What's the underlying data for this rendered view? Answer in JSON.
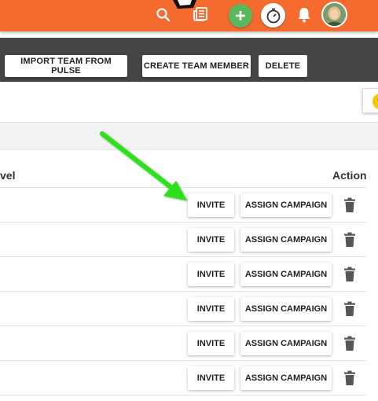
{
  "header": {
    "brand_color": "#f46a2f",
    "icons": [
      "search-icon",
      "newspaper-icon",
      "add-icon",
      "timer-icon",
      "bell-icon",
      "avatar"
    ]
  },
  "toolbar": {
    "import_label": "IMPORT TEAM FROM PULSE",
    "create_label": "CREATE TEAM MEMBER",
    "delete_label": "DELETE"
  },
  "help": {
    "label": "?"
  },
  "table": {
    "columns": {
      "level": "vel",
      "action": "Action"
    },
    "rows": [
      {
        "invite": "INVITE",
        "assign": "ASSIGN CAMPAIGN"
      },
      {
        "invite": "INVITE",
        "assign": "ASSIGN CAMPAIGN"
      },
      {
        "invite": "INVITE",
        "assign": "ASSIGN CAMPAIGN"
      },
      {
        "invite": "INVITE",
        "assign": "ASSIGN CAMPAIGN"
      },
      {
        "invite": "INVITE",
        "assign": "ASSIGN CAMPAIGN"
      },
      {
        "invite": "INVITE",
        "assign": "ASSIGN CAMPAIGN"
      }
    ]
  },
  "annotation": {
    "arrow_color": "#2ee01e"
  }
}
